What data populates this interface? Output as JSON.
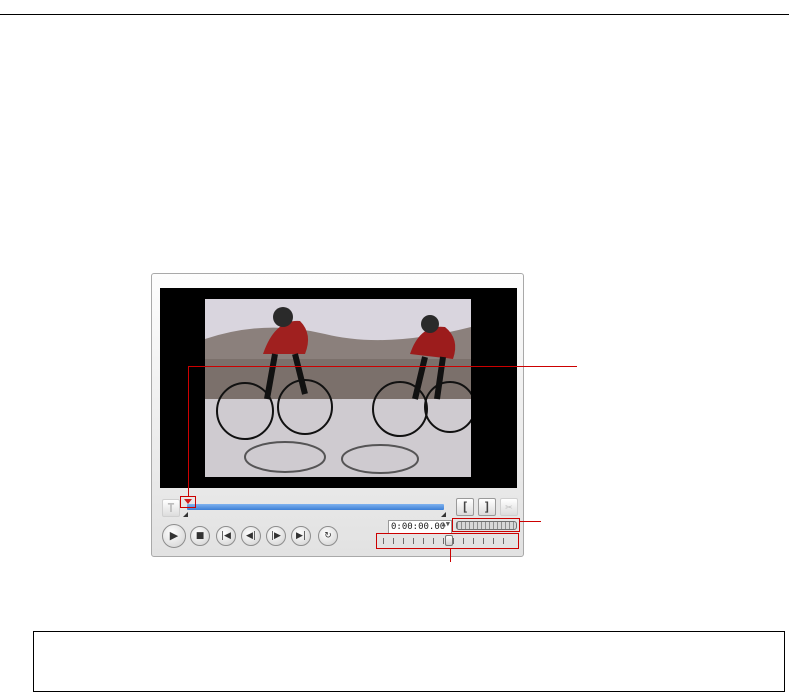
{
  "player": {
    "preview": {
      "frame_description_icon": "cyclists-video-frame"
    },
    "timeline": {
      "trim_buttons": {
        "mark_in": "[",
        "mark_out": "]",
        "cut": "✂"
      },
      "text_button": "T"
    },
    "controls": {
      "play": "▶",
      "stop": "■",
      "prev": "|◀",
      "step_back": "◀|",
      "step_forward": "|▶",
      "next": "▶|",
      "repeat": "↻"
    },
    "timecode": "0:00:00.00",
    "spin": "▲▼"
  },
  "colors": {
    "callout": "#cc0000",
    "scrub_bar": "#3c7fd6"
  }
}
